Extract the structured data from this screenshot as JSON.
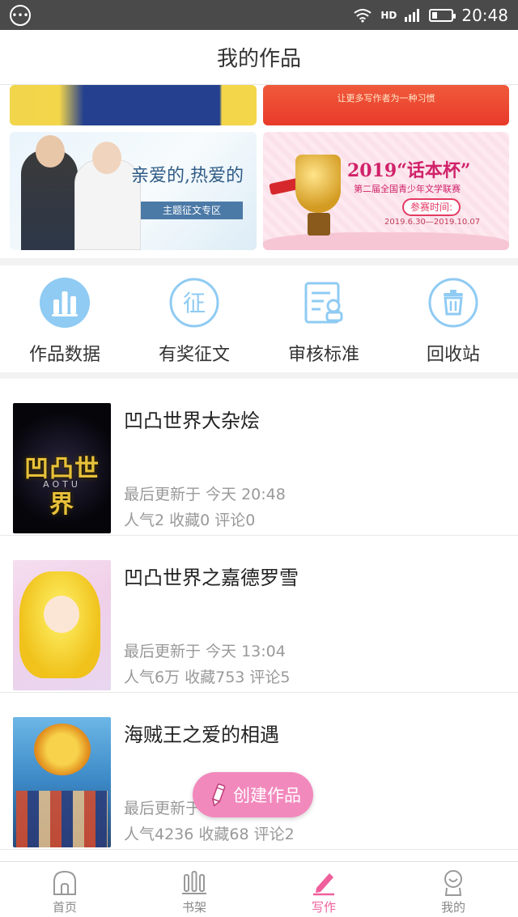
{
  "status_bar": {
    "time": "20:48",
    "network": "HD",
    "battery_level": 0.25
  },
  "header": {
    "title": "我的作品"
  },
  "banners": {
    "top_right_text": "让更多写作者为一种习惯",
    "bottom_left": {
      "slogan": "亲爱的,热爱的",
      "pill": "主题征文专区"
    },
    "bottom_right": {
      "headline": "2019“话本杯”",
      "subtitle": "第二届全国青少年文学联赛",
      "pill": "参赛时间:",
      "date_range": "2019.6.30—2019.10.07"
    }
  },
  "entries": [
    {
      "label": "作品数据",
      "icon": "bar-chart-icon"
    },
    {
      "label": "有奖征文",
      "icon": "contest-icon"
    },
    {
      "label": "审核标准",
      "icon": "review-standard-icon"
    },
    {
      "label": "回收站",
      "icon": "trash-icon"
    }
  ],
  "works": [
    {
      "title": "凹凸世界大杂烩",
      "updated": "最后更新于 今天 20:48",
      "stats": "人气2 收藏0 评论0",
      "cover_logo": "凹凸世界",
      "cover_sub": "AOTU"
    },
    {
      "title": "凹凸世界之嘉德罗雪",
      "updated": "最后更新于 今天 13:04",
      "stats": "人气6万 收藏753 评论5"
    },
    {
      "title": "海贼王之爱的相遇",
      "updated": "最后更新于",
      "stats": "人气4236 收藏68 评论2"
    }
  ],
  "fab": {
    "label": "创建作品",
    "color": "#f289bd"
  },
  "tabbar": {
    "active_color": "#ef5f9c",
    "items": [
      {
        "label": "首页",
        "icon": "home-icon"
      },
      {
        "label": "书架",
        "icon": "bookshelf-icon"
      },
      {
        "label": "写作",
        "icon": "pen-icon",
        "active": true
      },
      {
        "label": "我的",
        "icon": "profile-icon"
      }
    ]
  }
}
